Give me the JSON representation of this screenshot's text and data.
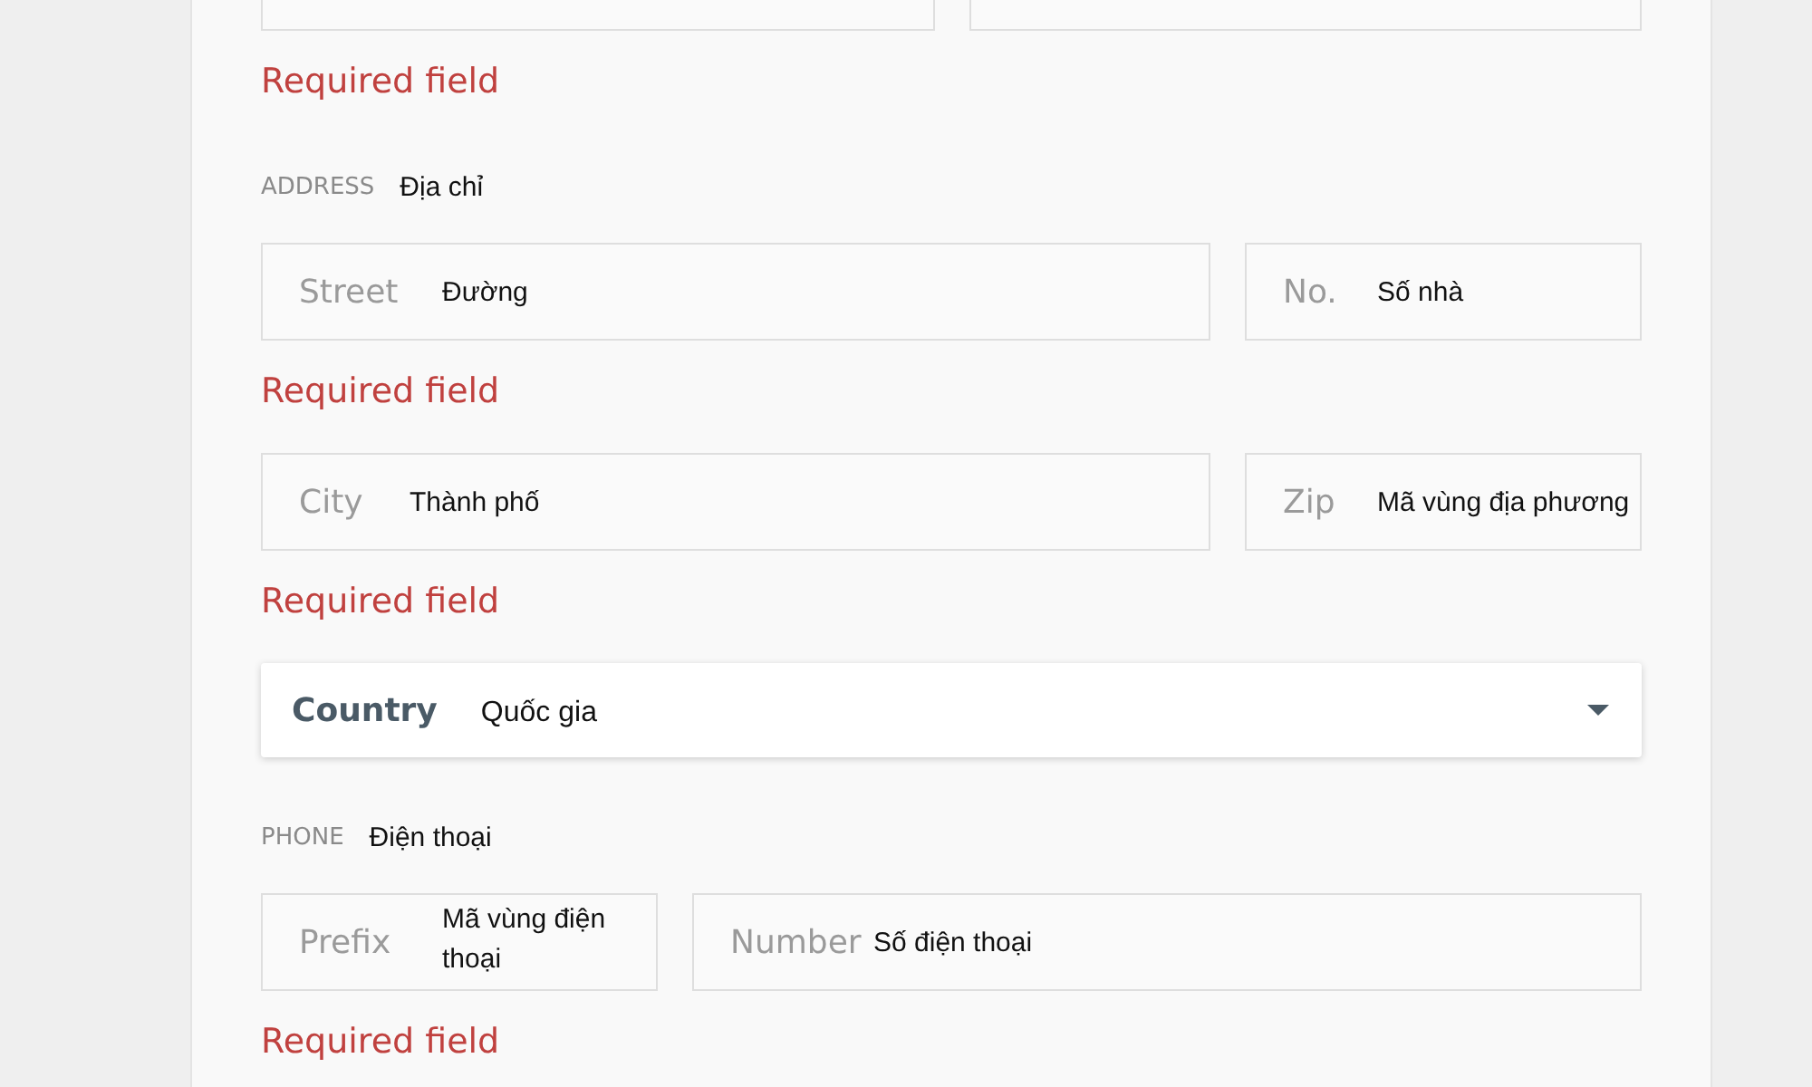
{
  "form": [
    {
      "kind": "cut-fields"
    },
    {
      "kind": "error",
      "text": "Required field"
    },
    {
      "kind": "section",
      "label": "ADDRESS",
      "note": "Địa chỉ"
    },
    {
      "kind": "fields",
      "fields": [
        {
          "placeholder": "Street",
          "note": "Đường",
          "wide": true
        },
        {
          "placeholder": "No.",
          "note": "Số nhà",
          "wide": false
        }
      ]
    },
    {
      "kind": "error",
      "text": "Required field"
    },
    {
      "kind": "fields",
      "fields": [
        {
          "placeholder": "City",
          "note": "Thành phố",
          "wide": true
        },
        {
          "placeholder": "Zip",
          "note": "Mã vùng địa phương",
          "wide": false
        }
      ]
    },
    {
      "kind": "error",
      "text": "Required field"
    },
    {
      "kind": "select",
      "label": "Country",
      "note": "Quốc gia"
    },
    {
      "kind": "section",
      "label": "PHONE",
      "note": "Điện thoại"
    },
    {
      "kind": "fields",
      "fields": [
        {
          "placeholder": "Prefix",
          "note": "Mã vùng điện thoại",
          "wide": false
        },
        {
          "placeholder": "Number",
          "note": "Số điện thoại",
          "wide": true
        }
      ]
    },
    {
      "kind": "error",
      "text": "Required field"
    }
  ]
}
